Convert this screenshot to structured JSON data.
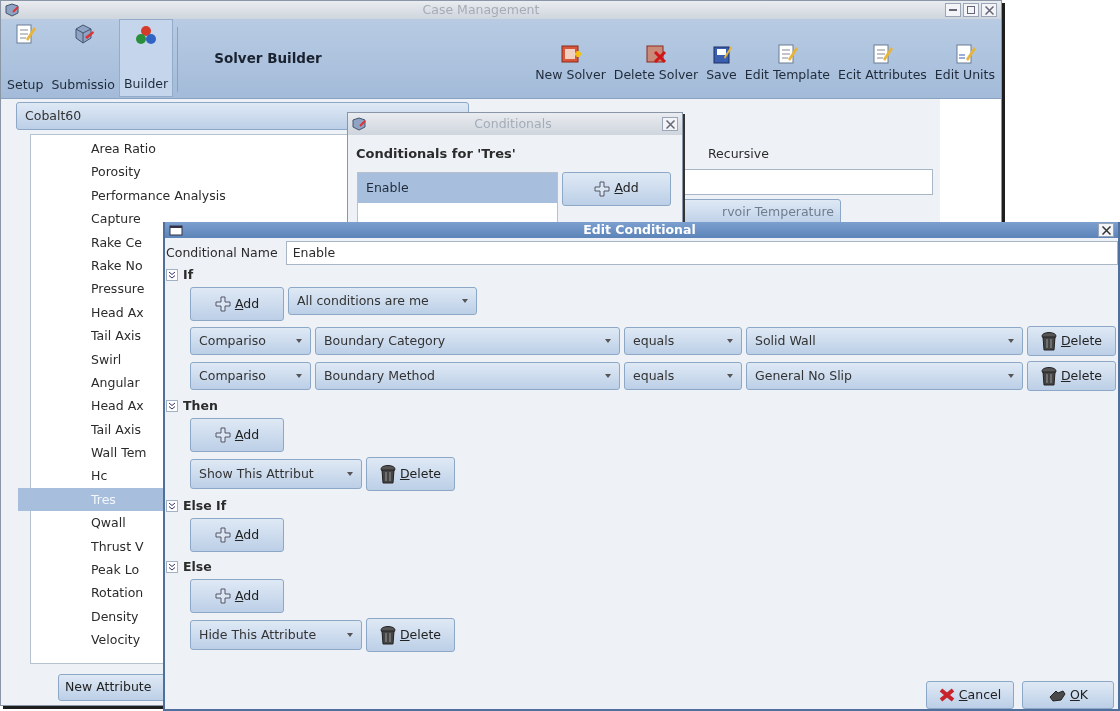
{
  "main_window": {
    "title": "Case Management",
    "nav_tools": [
      {
        "label": "Setup",
        "selected": false
      },
      {
        "label": "Submissio",
        "selected": false
      },
      {
        "label": "Builder",
        "selected": true
      }
    ],
    "page_title": "Solver Builder",
    "actions": [
      "New Solver",
      "Delete Solver",
      "Save",
      "Edit Template",
      "Ecit Attributes",
      "Edit Units"
    ],
    "solver_select": "Cobalt60",
    "attributes": [
      {
        "label": "Area Ratio",
        "selected": false
      },
      {
        "label": "Porosity",
        "selected": false
      },
      {
        "label": "Performance Analysis",
        "selected": false
      },
      {
        "label": "Capture",
        "selected": false
      },
      {
        "label": "Rake Ce",
        "selected": false
      },
      {
        "label": "Rake No",
        "selected": false
      },
      {
        "label": "Pressure",
        "selected": false
      },
      {
        "label": "Head Ax",
        "selected": false
      },
      {
        "label": "Tail Axis",
        "selected": false
      },
      {
        "label": "Swirl",
        "selected": false
      },
      {
        "label": "Angular",
        "selected": false
      },
      {
        "label": "Head Ax",
        "selected": false
      },
      {
        "label": "Tail Axis",
        "selected": false
      },
      {
        "label": "Wall Tem",
        "selected": false
      },
      {
        "label": "Hc",
        "selected": false
      },
      {
        "label": "Tres",
        "selected": true
      },
      {
        "label": "Qwall",
        "selected": false
      },
      {
        "label": "Thrust V",
        "selected": false
      },
      {
        "label": "Peak Lo",
        "selected": false
      },
      {
        "label": "Rotation",
        "selected": false
      },
      {
        "label": "Density",
        "selected": false
      },
      {
        "label": "Velocity",
        "selected": false
      }
    ],
    "new_attribute_button": "New Attribute",
    "recursive_label": "Recursive",
    "temperature_button": "rvoir Temperature"
  },
  "conditionals_window": {
    "title": "Conditionals",
    "heading": "Conditionals for 'Tres'",
    "items": [
      {
        "label": "Enable",
        "selected": true
      }
    ],
    "add_button": "Add"
  },
  "edit_window": {
    "title": "Edit Conditional",
    "name_label": "Conditional Name",
    "name_value": "Enable",
    "sections": [
      {
        "label": "If",
        "expanded": true,
        "add_button": "Add",
        "match_select": "All conditions are me",
        "conditions": [
          {
            "type": "Compariso",
            "field": "Boundary Category",
            "operator": "equals",
            "value": "Solid Wall",
            "delete_button": "Delete"
          },
          {
            "type": "Compariso",
            "field": "Boundary Method",
            "operator": "equals",
            "value": "General No Slip",
            "delete_button": "Delete"
          }
        ]
      },
      {
        "label": "Then",
        "expanded": true,
        "add_button": "Add",
        "actions": [
          {
            "select": "Show This Attribut",
            "delete_button": "Delete"
          }
        ]
      },
      {
        "label": "Else If",
        "expanded": true,
        "add_button": "Add"
      },
      {
        "label": "Else",
        "expanded": true,
        "add_button": "Add",
        "actions": [
          {
            "select": "Hide This Attribute",
            "delete_button": "Delete"
          }
        ]
      }
    ],
    "cancel_button": "Cancel",
    "ok_button": "OK"
  }
}
